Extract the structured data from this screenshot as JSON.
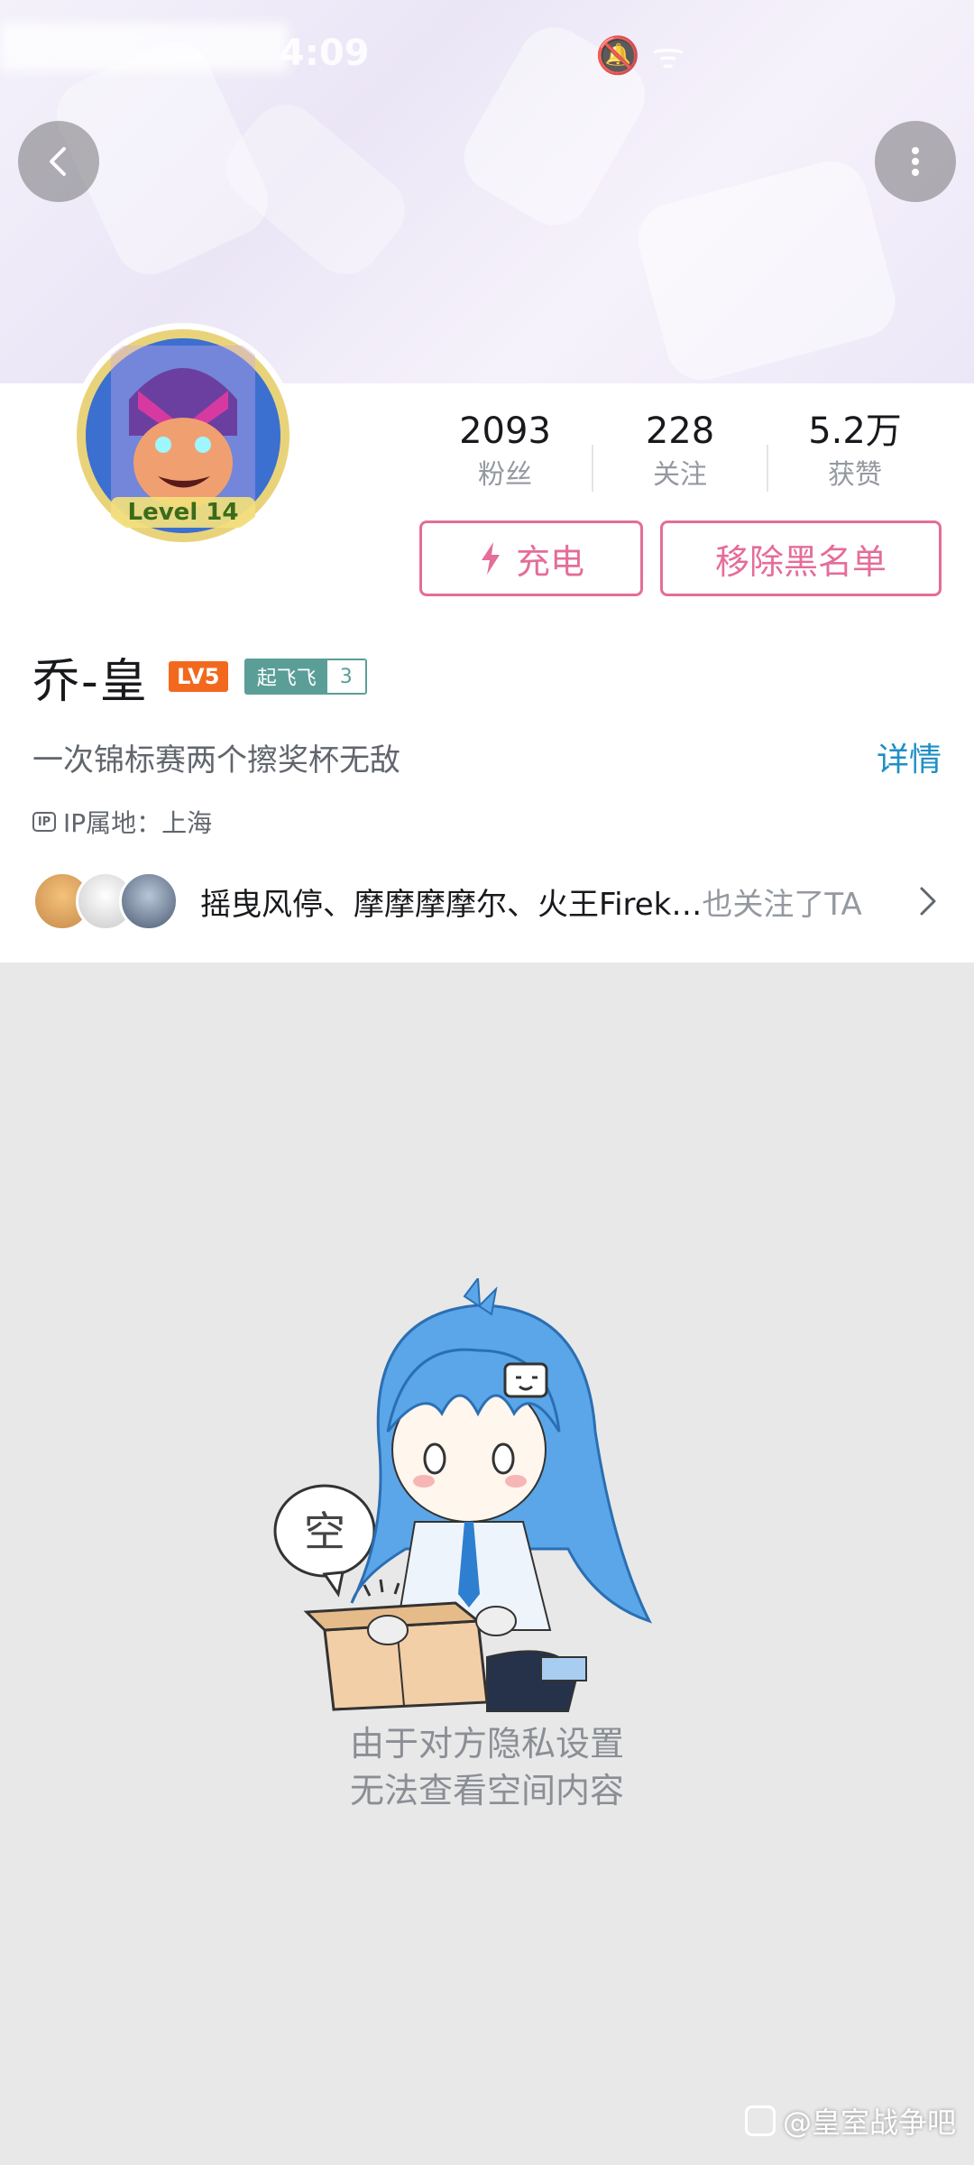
{
  "status_bar": {
    "time": "4:09",
    "icons": "🔕 ᯤ"
  },
  "header": {
    "back_icon": "chevron-left-icon",
    "more_icon": "more-vertical-icon"
  },
  "stats": [
    {
      "value": "2093",
      "label": "粉丝"
    },
    {
      "value": "228",
      "label": "关注"
    },
    {
      "value": "5.2万",
      "label": "获赞"
    }
  ],
  "buttons": {
    "charge": "充电",
    "unblock": "移除黑名单"
  },
  "user": {
    "name": "乔-皇",
    "level": "LV5",
    "fan_medal_name": "起飞飞",
    "fan_medal_level": "3",
    "signature": "一次锦标赛两个擦奖杯无敌",
    "detail_link": "详情",
    "ip_label": "IP属地：上海",
    "avatar_text": "Level 14"
  },
  "mutual_follow": {
    "names": "摇曳风停、摩摩摩摩尔、火王Firek…",
    "suffix": "也关注了TA"
  },
  "empty_state": {
    "bubble": "空",
    "line1": "由于对方隐私设置",
    "line2": "无法查看空间内容"
  },
  "watermark": "@皇室战争吧",
  "colors": {
    "accent_pink": "#e46d99",
    "link_blue": "#1e8fc6",
    "level_orange": "#f2691e",
    "medal_teal": "#5a9e97"
  }
}
